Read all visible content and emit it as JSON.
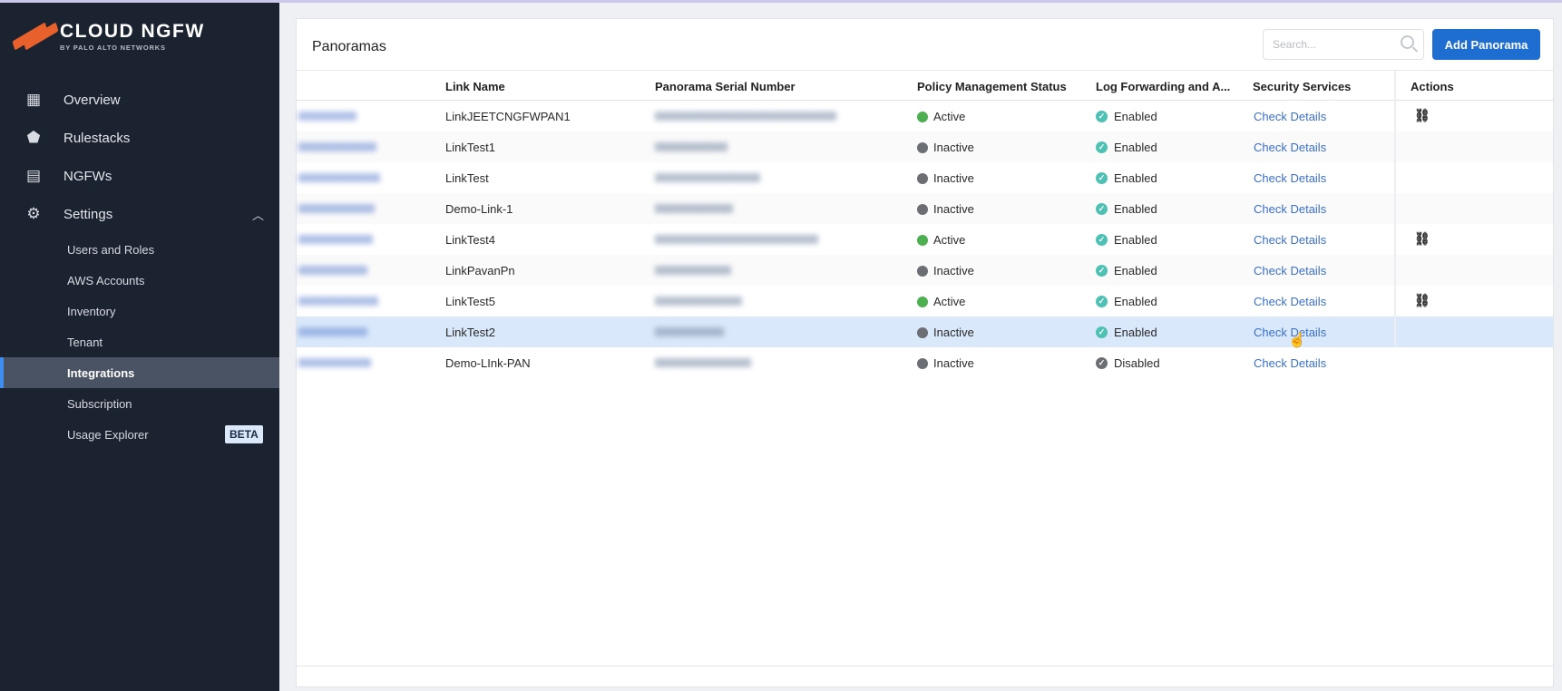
{
  "brand": {
    "title": "CLOUD NGFW",
    "subtitle": "BY PALO ALTO NETWORKS"
  },
  "sidebar": {
    "items": [
      {
        "label": "Overview",
        "icon": "grid-icon"
      },
      {
        "label": "Rulestacks",
        "icon": "shield-icon"
      },
      {
        "label": "NGFWs",
        "icon": "server-icon"
      },
      {
        "label": "Settings",
        "icon": "gear-icon"
      }
    ],
    "settings_sub": [
      {
        "label": "Users and Roles"
      },
      {
        "label": "AWS Accounts"
      },
      {
        "label": "Inventory"
      },
      {
        "label": "Tenant"
      },
      {
        "label": "Integrations",
        "active": true
      },
      {
        "label": "Subscription"
      },
      {
        "label": "Usage Explorer",
        "badge": "BETA"
      }
    ]
  },
  "main": {
    "title": "Panoramas",
    "search_placeholder": "Search...",
    "add_button": "Add Panorama",
    "columns": [
      "Link Name",
      "Panorama Serial Number",
      "Policy Management Status",
      "Log Forwarding and A...",
      "Security Services",
      "Actions"
    ],
    "rows": [
      {
        "link_name": "LinkJEETCNGFWPAN1",
        "status": "Active",
        "log": "Enabled",
        "security": "Check Details",
        "action": "unlink-icon"
      },
      {
        "link_name": "LinkTest1",
        "status": "Inactive",
        "log": "Enabled",
        "security": "Check Details"
      },
      {
        "link_name": "LinkTest",
        "status": "Inactive",
        "log": "Enabled",
        "security": "Check Details"
      },
      {
        "link_name": "Demo-Link-1",
        "status": "Inactive",
        "log": "Enabled",
        "security": "Check Details"
      },
      {
        "link_name": "LinkTest4",
        "status": "Active",
        "log": "Enabled",
        "security": "Check Details",
        "action": "unlink-icon"
      },
      {
        "link_name": "LinkPavanPn",
        "status": "Inactive",
        "log": "Enabled",
        "security": "Check Details"
      },
      {
        "link_name": "LinkTest5",
        "status": "Active",
        "log": "Enabled",
        "security": "Check Details",
        "action": "unlink-icon"
      },
      {
        "link_name": "LinkTest2",
        "status": "Inactive",
        "log": "Enabled",
        "security": "Check Details",
        "selected": true
      },
      {
        "link_name": "Demo-LInk-PAN",
        "status": "Inactive",
        "log": "Disabled",
        "security": "Check Details"
      }
    ]
  },
  "colors": {
    "active": "#4caf50",
    "inactive": "#6b6e73",
    "enabled": "#4fc1b4",
    "disabled": "#6b6e73",
    "accent": "#1e6dd0"
  }
}
